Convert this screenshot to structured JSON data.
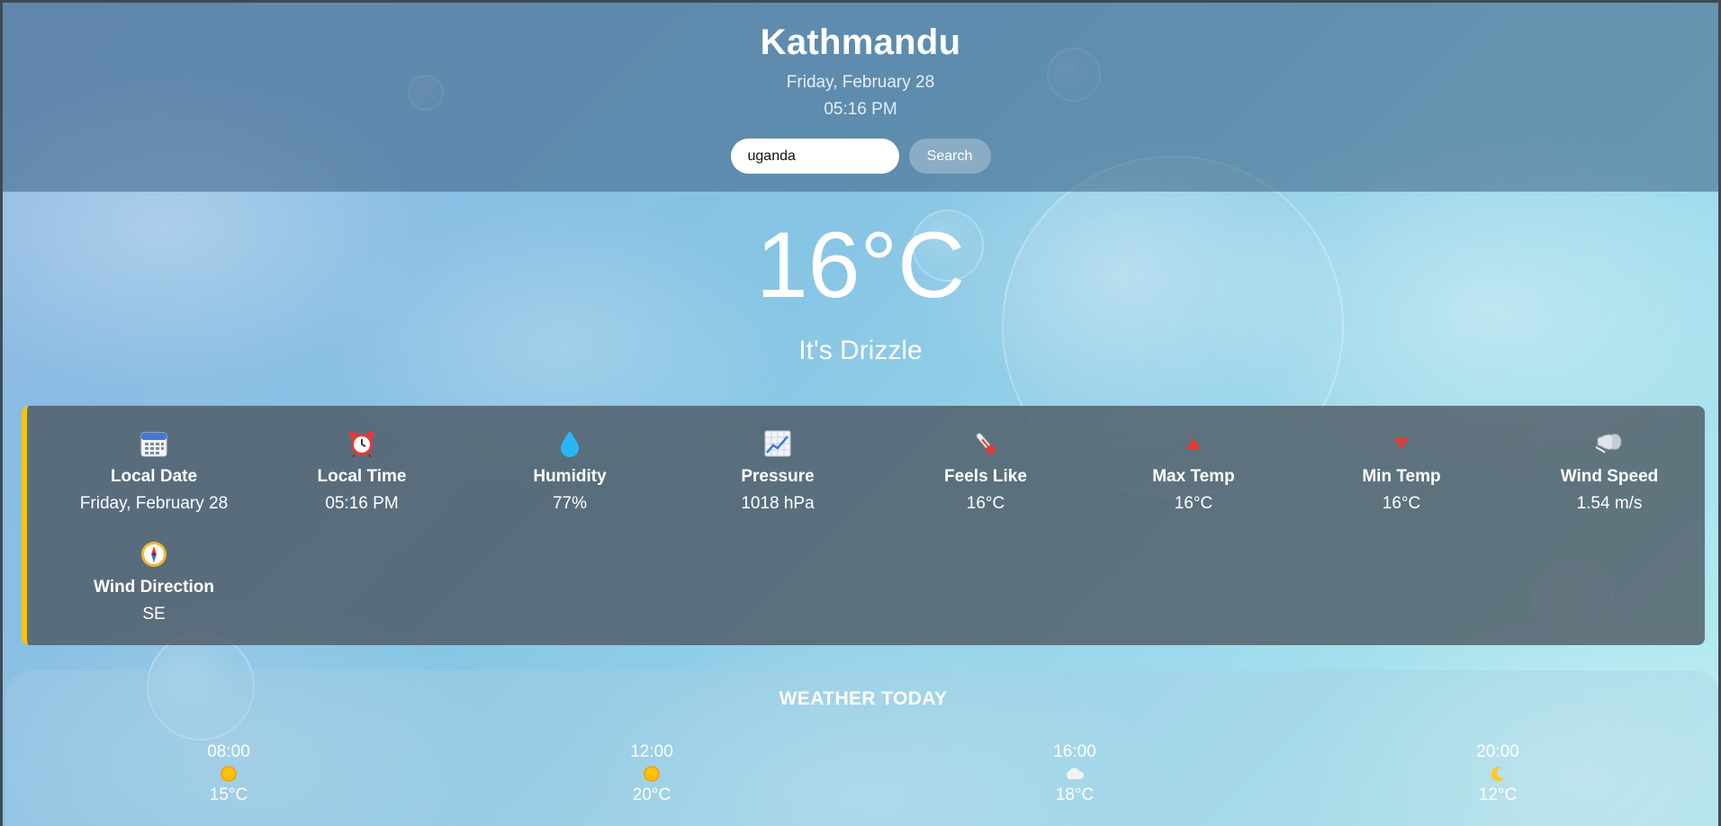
{
  "header": {
    "city": "Kathmandu",
    "date": "Friday, February 28",
    "time": "05:16 PM"
  },
  "search": {
    "value": "uganda",
    "button_label": "Search"
  },
  "current": {
    "temperature": "16°C",
    "condition": "It's Drizzle"
  },
  "details": [
    {
      "icon": "calendar-icon",
      "label": "Local Date",
      "value": "Friday, February 28"
    },
    {
      "icon": "alarm-clock-icon",
      "label": "Local Time",
      "value": "05:16 PM"
    },
    {
      "icon": "droplet-icon",
      "label": "Humidity",
      "value": "77%"
    },
    {
      "icon": "chart-icon",
      "label": "Pressure",
      "value": "1018 hPa"
    },
    {
      "icon": "thermometer-icon",
      "label": "Feels Like",
      "value": "16°C"
    },
    {
      "icon": "triangle-up-icon",
      "label": "Max Temp",
      "value": "16°C"
    },
    {
      "icon": "triangle-down-icon",
      "label": "Min Temp",
      "value": "16°C"
    },
    {
      "icon": "wind-icon",
      "label": "Wind Speed",
      "value": "1.54 m/s"
    },
    {
      "icon": "compass-icon",
      "label": "Wind Direction",
      "value": "SE"
    }
  ],
  "forecast": {
    "title": "WEATHER TODAY",
    "items": [
      {
        "time": "08:00",
        "icon": "sun-icon",
        "temp": "15°C"
      },
      {
        "time": "12:00",
        "icon": "sun-icon",
        "temp": "20°C"
      },
      {
        "time": "16:00",
        "icon": "cloud-icon",
        "temp": "18°C"
      },
      {
        "time": "20:00",
        "icon": "moon-icon",
        "temp": "12°C"
      }
    ]
  },
  "colors": {
    "accent": "#f1c40f",
    "card": "#4b555f",
    "header": "#3c5f82",
    "arrow": "#e53935"
  }
}
